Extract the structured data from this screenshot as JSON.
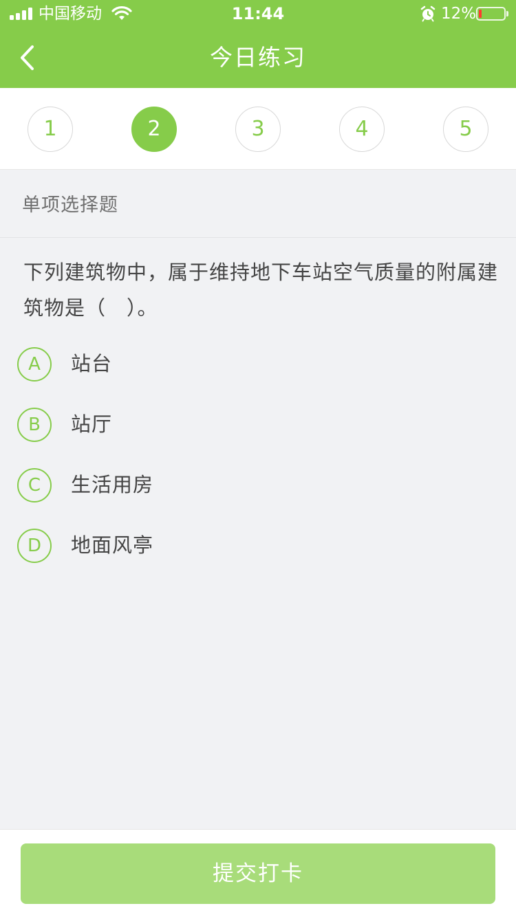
{
  "status_bar": {
    "carrier": "中国移动",
    "time": "11:44",
    "battery": "12%",
    "battery_fraction": 0.12
  },
  "nav": {
    "back_icon": "chevron-left-icon",
    "title": "今日练习"
  },
  "question_numbers": [
    {
      "label": "1",
      "active": false
    },
    {
      "label": "2",
      "active": true
    },
    {
      "label": "3",
      "active": false
    },
    {
      "label": "4",
      "active": false
    },
    {
      "label": "5",
      "active": false
    }
  ],
  "question": {
    "type": "单项选择题",
    "text": "下列建筑物中，属于维持地下车站空气质量的附属建筑物是（　）。",
    "options": [
      {
        "key": "A",
        "text": "站台"
      },
      {
        "key": "B",
        "text": "站厅"
      },
      {
        "key": "C",
        "text": "生活用房"
      },
      {
        "key": "D",
        "text": "地面风亭"
      }
    ]
  },
  "footer": {
    "submit_label": "提交打卡"
  },
  "colors": {
    "accent": "#86cc4a",
    "submit_bg": "#a8dc7a",
    "page_bg": "#f1f2f4",
    "battery_low": "#ff3b30"
  }
}
